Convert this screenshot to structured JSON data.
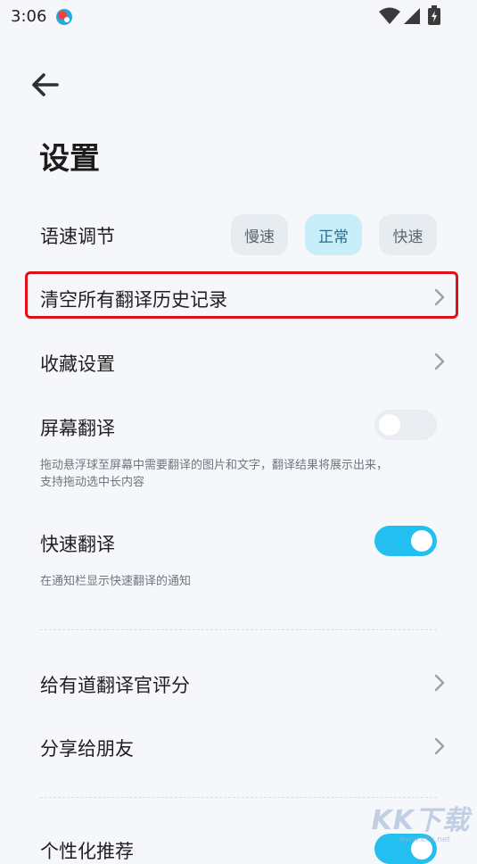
{
  "status_bar": {
    "time": "3:06"
  },
  "page": {
    "title": "设置"
  },
  "speech_speed": {
    "label": "语速调节",
    "options": [
      "慢速",
      "正常",
      "快速"
    ],
    "selected": "正常"
  },
  "clear_history": {
    "label": "清空所有翻译历史记录"
  },
  "favorites": {
    "label": "收藏设置"
  },
  "screen_translate": {
    "label": "屏幕翻译",
    "enabled": false,
    "hint": "拖动悬浮球至屏幕中需要翻译的图片和文字，翻译结果将展示出来，支持拖动选中长内容"
  },
  "quick_translate": {
    "label": "快速翻译",
    "enabled": true,
    "hint": "在通知栏显示快速翻译的通知"
  },
  "rate_app": {
    "label": "给有道翻译官评分"
  },
  "share": {
    "label": "分享给朋友"
  },
  "personalized": {
    "label": "个性化推荐",
    "enabled": true
  },
  "watermark": {
    "text": "KK下载",
    "sub": "www.kkx.net"
  },
  "colors": {
    "accent": "#23bff0",
    "highlight_border": "#e0101a"
  }
}
